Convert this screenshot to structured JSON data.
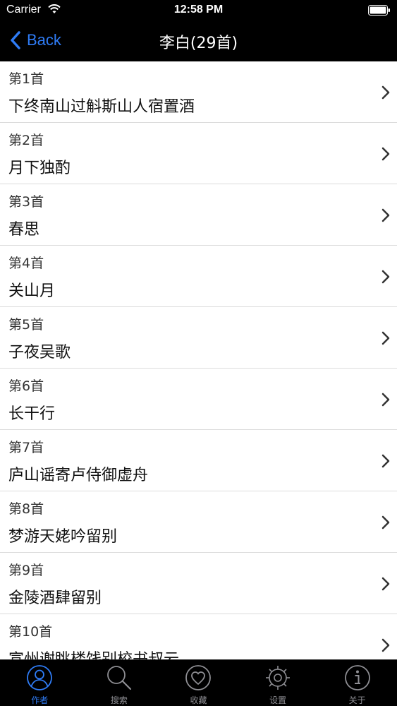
{
  "status_bar": {
    "carrier": "Carrier",
    "time": "12:58 PM"
  },
  "nav": {
    "back_label": "Back",
    "title": "李白(29首)"
  },
  "poems": [
    {
      "index": "第1首",
      "title": "下终南山过斛斯山人宿置酒"
    },
    {
      "index": "第2首",
      "title": "月下独酌"
    },
    {
      "index": "第3首",
      "title": "春思"
    },
    {
      "index": "第4首",
      "title": "关山月"
    },
    {
      "index": "第5首",
      "title": "子夜吴歌"
    },
    {
      "index": "第6首",
      "title": "长干行"
    },
    {
      "index": "第7首",
      "title": "庐山谣寄卢侍御虚舟"
    },
    {
      "index": "第8首",
      "title": "梦游天姥吟留别"
    },
    {
      "index": "第9首",
      "title": "金陵酒肆留别"
    },
    {
      "index": "第10首",
      "title": "宣州谢眺楼饯别校书叔云"
    }
  ],
  "tabs": [
    {
      "label": "作者",
      "icon": "person-icon",
      "active": true
    },
    {
      "label": "搜索",
      "icon": "search-icon",
      "active": false
    },
    {
      "label": "收藏",
      "icon": "heart-icon",
      "active": false
    },
    {
      "label": "设置",
      "icon": "gear-icon",
      "active": false
    },
    {
      "label": "关于",
      "icon": "info-icon",
      "active": false
    }
  ],
  "colors": {
    "accent": "#2f7cf6",
    "bar_background": "#000000",
    "inactive_tab": "#8e8e93"
  }
}
